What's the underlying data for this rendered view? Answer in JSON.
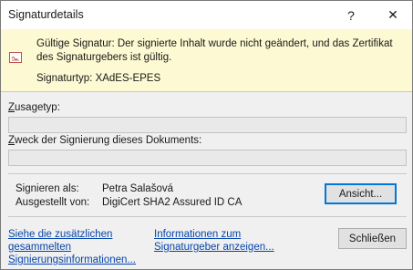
{
  "window": {
    "title": "Signaturdetails",
    "help_glyph": "?",
    "close_glyph": "✕"
  },
  "banner": {
    "icon": "signature-certificate-icon",
    "message": "Gültige Signatur: Der signierte Inhalt wurde nicht geändert, und das Zertifikat des Signaturgebers ist gültig.",
    "signature_type": "Signaturtyp: XAdES-EPES",
    "background_color": "#fdf9d2"
  },
  "commitment": {
    "label_underlined": "Z",
    "label_rest": "usagetyp:",
    "value": ""
  },
  "purpose": {
    "label_underlined": "Z",
    "label_rest": "weck der Signierung dieses Dokuments:",
    "value": ""
  },
  "signer": {
    "signed_as_label": "Signieren als:",
    "signed_as_value": "Petra Salašová",
    "issued_by_label": "Ausgestellt von:",
    "issued_by_value": "DigiCert SHA2 Assured ID CA",
    "view_button_label": "Ansicht..."
  },
  "footer": {
    "link_additional_info": [
      "Siehe die zusätzlichen",
      "gesammelten",
      "Signierungsinformationen..."
    ],
    "link_signer_info": [
      "Informationen zum",
      "Signaturgeber anzeigen..."
    ],
    "close_button_label": "Schließen"
  },
  "colors": {
    "link": "#0645ad",
    "focus_border": "#0078d7"
  }
}
